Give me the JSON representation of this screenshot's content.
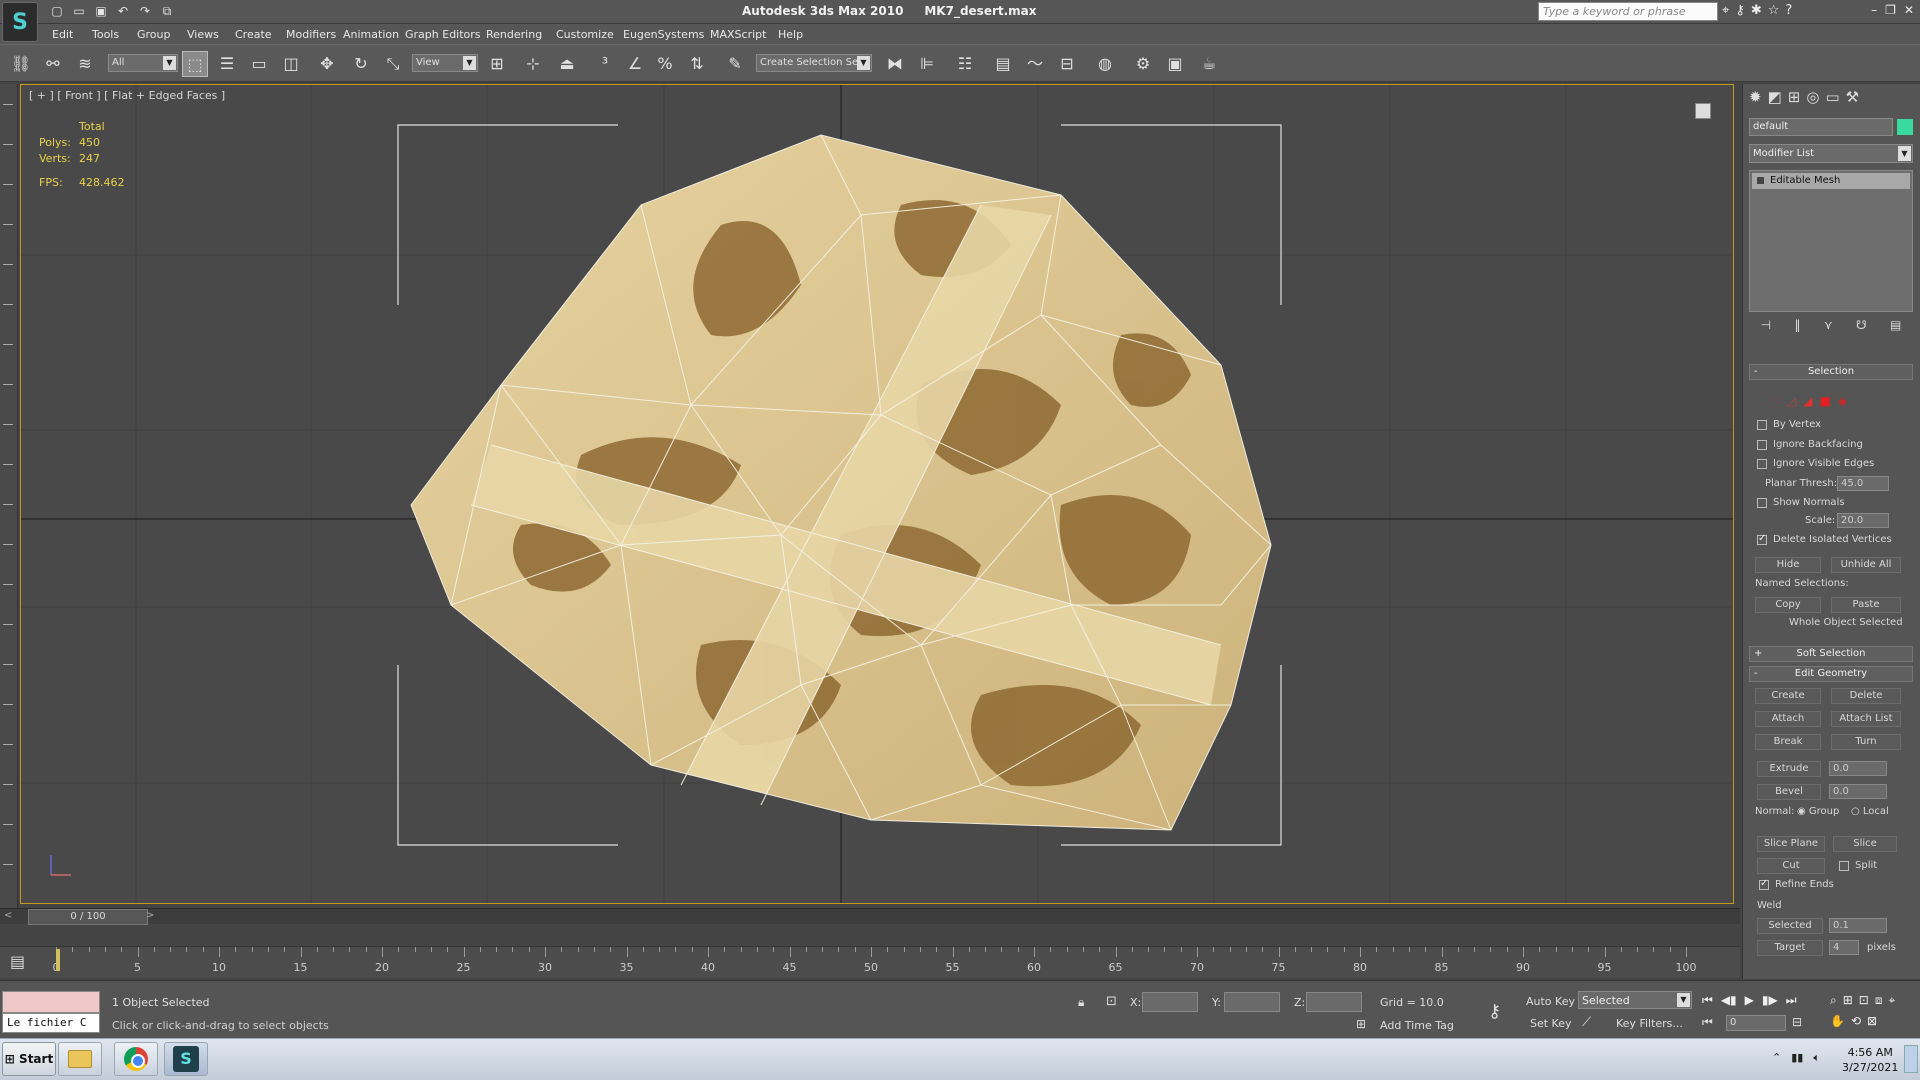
{
  "title_bar": {
    "app_logo": "S",
    "app_name": "Autodesk 3ds Max  2010",
    "file_name": "MK7_desert.max",
    "search_placeholder": "Type a keyword or phrase"
  },
  "menu": [
    "Edit",
    "Tools",
    "Group",
    "Views",
    "Create",
    "Modifiers",
    "Animation",
    "Graph Editors",
    "Rendering",
    "Customize",
    "EugenSystems",
    "MAXScript",
    "Help"
  ],
  "toolbar": {
    "selection_filter": "All",
    "reference_coord": "View",
    "named_selection": "Create Selection Se"
  },
  "viewport": {
    "label": "[ + ] [ Front ] [ Flat + Edged Faces ]",
    "stats": {
      "total_label": "Total",
      "polys_label": "Polys:",
      "polys": "450",
      "verts_label": "Verts:",
      "verts": "247",
      "fps_label": "FPS:",
      "fps": "428.462"
    }
  },
  "command_panel": {
    "object_name": "default",
    "object_color": "#3ad9a2",
    "modifier_list": "Modifier List",
    "stack": [
      "Editable Mesh"
    ],
    "selection": {
      "title": "Selection",
      "by_vertex": "By Vertex",
      "ignore_backfacing": "Ignore Backfacing",
      "ignore_visible_edges": "Ignore Visible Edges",
      "planar_thresh_label": "Planar Thresh:",
      "planar_thresh": "45.0",
      "show_normals": "Show Normals",
      "scale_label": "Scale:",
      "scale": "20.0",
      "delete_isolated": "Delete Isolated Vertices",
      "hide": "Hide",
      "unhide_all": "Unhide All",
      "named_selections": "Named Selections:",
      "copy": "Copy",
      "paste": "Paste",
      "whole_object": "Whole Object Selected"
    },
    "soft_selection": "Soft Selection",
    "edit_geometry": {
      "title": "Edit Geometry",
      "create": "Create",
      "delete": "Delete",
      "attach": "Attach",
      "attach_list": "Attach List",
      "break": "Break",
      "turn": "Turn",
      "extrude": "Extrude",
      "extrude_val": "0.0",
      "bevel": "Bevel",
      "bevel_val": "0.0",
      "normal_label": "Normal:",
      "group": "Group",
      "local": "Local",
      "slice_plane": "Slice Plane",
      "slice": "Slice",
      "cut": "Cut",
      "split": "Split",
      "refine_ends": "Refine Ends",
      "weld": "Weld",
      "selected": "Selected",
      "selected_val": "0.1",
      "target": "Target",
      "target_val": "4",
      "pixels": "pixels"
    }
  },
  "trackbar": {
    "frame_counter": "0 / 100",
    "prev": "<",
    "next": ">"
  },
  "timeline": {
    "ticks": [
      "0",
      "5",
      "10",
      "15",
      "20",
      "25",
      "30",
      "35",
      "40",
      "45",
      "50",
      "55",
      "60",
      "65",
      "70",
      "75",
      "80",
      "85",
      "90",
      "95",
      "100"
    ]
  },
  "status": {
    "maxscript_output": "Le fichier C",
    "objects_selected": "1 Object Selected",
    "prompt": "Click or click-and-drag to select objects",
    "x_label": "X:",
    "y_label": "Y:",
    "z_label": "Z:",
    "grid": "Grid = 10.0",
    "add_time_tag": "Add Time Tag",
    "auto_key": "Auto Key",
    "set_key": "Set Key",
    "selection_set": "Selected",
    "key_filters": "Key Filters...",
    "current_frame": "0"
  },
  "taskbar": {
    "start": "Start",
    "time": "4:56 AM",
    "date": "3/27/2021"
  }
}
